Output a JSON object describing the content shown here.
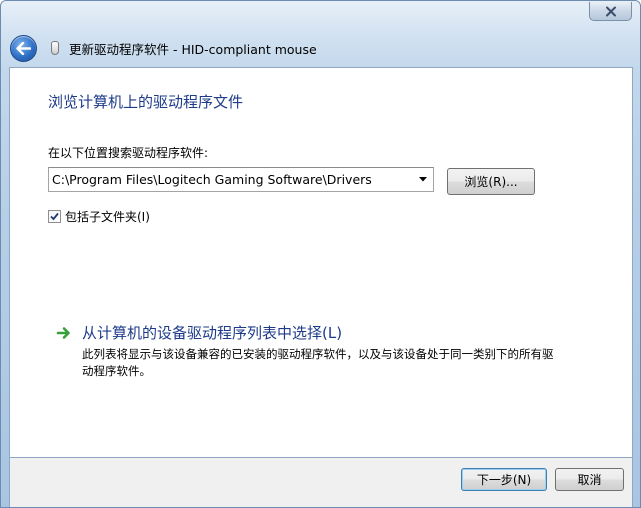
{
  "window": {
    "title": "更新驱动程序软件 - HID-compliant mouse",
    "close_icon": "close-icon",
    "back_icon": "back-arrow-icon",
    "device_icon": "mouse-device-icon"
  },
  "content": {
    "heading": "浏览计算机上的驱动程序文件",
    "search_label": "在以下位置搜索驱动程序软件:",
    "path_value": "C:\\Program Files\\Logitech Gaming Software\\Drivers",
    "browse_button": "浏览(R)...",
    "include_subfolders": {
      "label": "包括子文件夹(I)",
      "checked": true
    },
    "pick_option": {
      "icon": "green-arrow-icon",
      "title": "从计算机的设备驱动程序列表中选择(L)",
      "description": "此列表将显示与该设备兼容的已安装的驱动程序软件，以及与该设备处于同一类别下的所有驱动程序软件。"
    }
  },
  "footer": {
    "next_button": "下一步(N)",
    "cancel_button": "取消"
  },
  "colors": {
    "heading": "#1e3b8a",
    "frame": "#b7cfe7",
    "arrow_green": "#3aa13a"
  }
}
